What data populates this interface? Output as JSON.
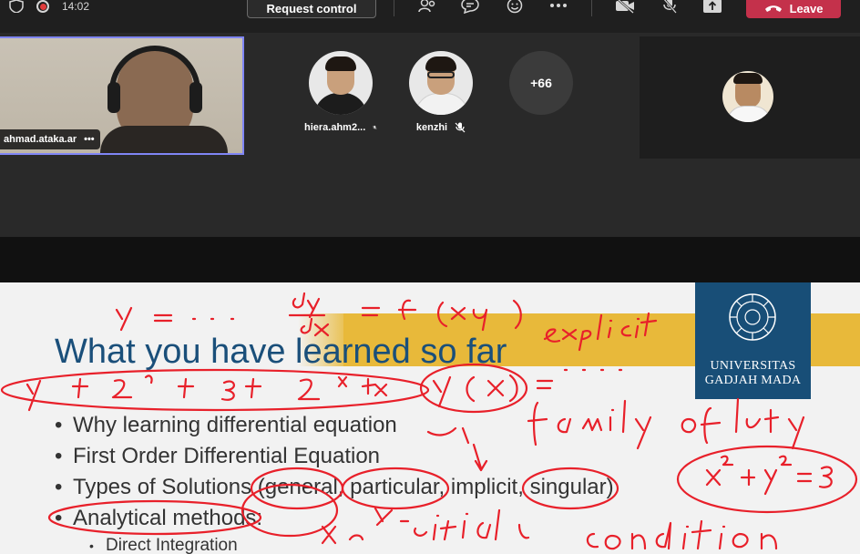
{
  "topbar": {
    "time": "14:02",
    "request_control_label": "Request control",
    "leave_label": "Leave",
    "icons": [
      "shield-icon",
      "record-icon",
      "people-icon",
      "chat-icon",
      "reactions-icon",
      "more-icon",
      "camera-off-icon",
      "mic-off-icon",
      "share-icon",
      "phone-icon"
    ]
  },
  "participants": {
    "self_name": "ahmad.ataka.ar",
    "self_more": "•••",
    "tiles": [
      {
        "name": "hiera.ahm2..."
      },
      {
        "name": "kenzhi"
      }
    ],
    "overflow_count": "+66"
  },
  "slide": {
    "title": "What you have learned so far",
    "bullets": [
      "Why learning differential equation",
      "First Order Differential Equation",
      "Types of Solutions (general, particular, implicit, singular)",
      "Analytical methods:"
    ],
    "sub_bullets": [
      "Direct Integration"
    ],
    "logo_line1": "UNIVERSITAS",
    "logo_line2": "GADJAH MADA"
  },
  "colors": {
    "accent": "#7f85f5",
    "leave": "#c4314b",
    "ugm_blue": "#184e77",
    "gold": "#e8b93a",
    "ink": "#e8202a",
    "title_blue": "#1a4f7a"
  }
}
